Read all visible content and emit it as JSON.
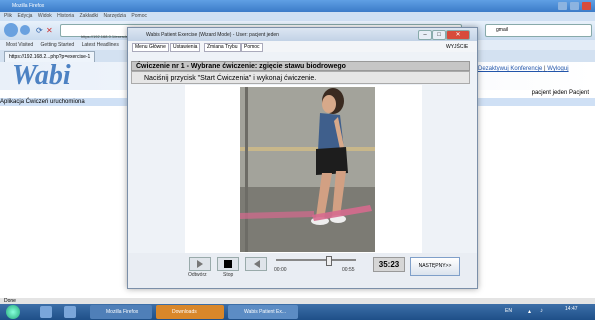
{
  "browser": {
    "title": "Mozilla Firefox",
    "menu": [
      "Plik",
      "Edycja",
      "Widok",
      "Historia",
      "Zakładki",
      "Narzędzia",
      "Pomoc"
    ],
    "url": "https://192.168.0.1/exercise.php?p=exercise-1",
    "search": "gmail",
    "bookmarks": [
      "Most Visited",
      "Getting Started",
      "Latest Headlines"
    ],
    "tab_label": "https://192.168.2...php?p=exercise-1"
  },
  "page": {
    "logo": "Wabi",
    "conference_link": "Dezaktywuj Konferencje",
    "logout_link": "Wyloguj",
    "user_label": "pacjent jeden Pacjent",
    "status_message": "Aplikacja Ćwiczeń uruchomiona"
  },
  "dialog": {
    "title": "Wabis Patient Exercise (Wizard Mode) - User: pacjent jeden",
    "menu": [
      "Menu Główne",
      "Ustawienia",
      "Zmiana Trybu",
      "Pomoc"
    ],
    "exit_label": "WYJŚCIE",
    "exercise_header": "Ćwiczenie nr 1 - Wybrane ćwiczenie: zgięcie stawu biodrowego",
    "instruction": "Naciśnij przycisk \"Start Ćwiczenia\" i wykonaj ćwiczenie.",
    "controls": {
      "play_label": "Odtwórz",
      "stop_label": "Stop",
      "time_start": "00:00",
      "time_end": "00:55",
      "timer": "35:23",
      "next_label": "NASTĘPNY>>",
      "progress": 0.62
    }
  },
  "status_bar": "Done",
  "taskbar": {
    "tasks": [
      "Mozilla Firefox",
      "Downloads",
      "Wabis Patient Ex..."
    ],
    "language": "EN",
    "clock": "14:47"
  },
  "colors": {
    "accent": "#3b7bc8",
    "exercise_band": "#d66a8e"
  }
}
